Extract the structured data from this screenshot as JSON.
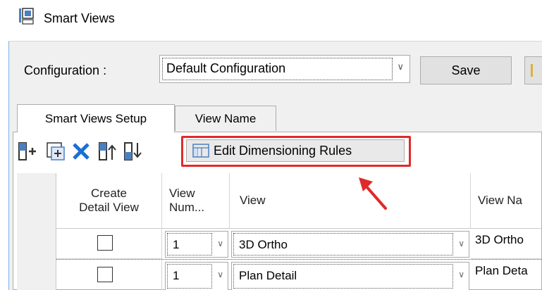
{
  "window": {
    "title": "Smart Views",
    "icon": "smart-views-icon"
  },
  "configuration": {
    "label": "Configuration  :",
    "selected": "Default Configuration",
    "save_label": "Save"
  },
  "tabs": [
    {
      "label": "Smart Views Setup",
      "active": true
    },
    {
      "label": "View Name",
      "active": false
    }
  ],
  "toolbar": {
    "buttons": [
      "add-row-icon",
      "insert-icon",
      "delete-icon",
      "move-up-icon",
      "move-down-icon"
    ],
    "edit_dimensioning_label": "Edit Dimensioning Rules"
  },
  "grid": {
    "columns": [
      "Create\nDetail View",
      "View\nNum...",
      "View",
      "View Na"
    ],
    "rows": [
      {
        "create_detail": false,
        "view_num": "1",
        "view": "3D Ortho",
        "view_name": "3D Ortho"
      },
      {
        "create_detail": false,
        "view_num": "1",
        "view": "Plan Detail",
        "view_name": "Plan Deta"
      }
    ]
  },
  "colors": {
    "highlight": "#e02a2a",
    "delete": "#1a6fd6",
    "accent": "#7fb1e6"
  }
}
